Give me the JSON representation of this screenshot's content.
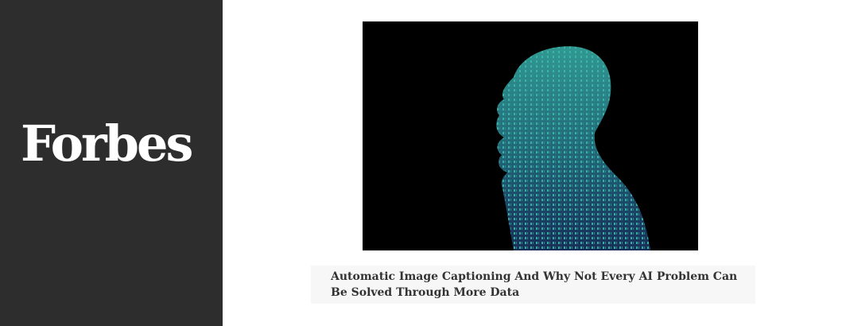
{
  "brand": {
    "logo_text": "Forbes",
    "sidebar_color": "#2d2d2d"
  },
  "article": {
    "image_icon": "binary-head-silhouette",
    "title": "Automatic Image Captioning And Why Not Every AI Problem Can Be Solved Through More Data"
  },
  "colors": {
    "image_background": "#000000",
    "digit_teal": "#3bb8a8",
    "digit_blue": "#2f5fb0",
    "caption_background": "#f7f7f7",
    "caption_text": "#333333"
  }
}
